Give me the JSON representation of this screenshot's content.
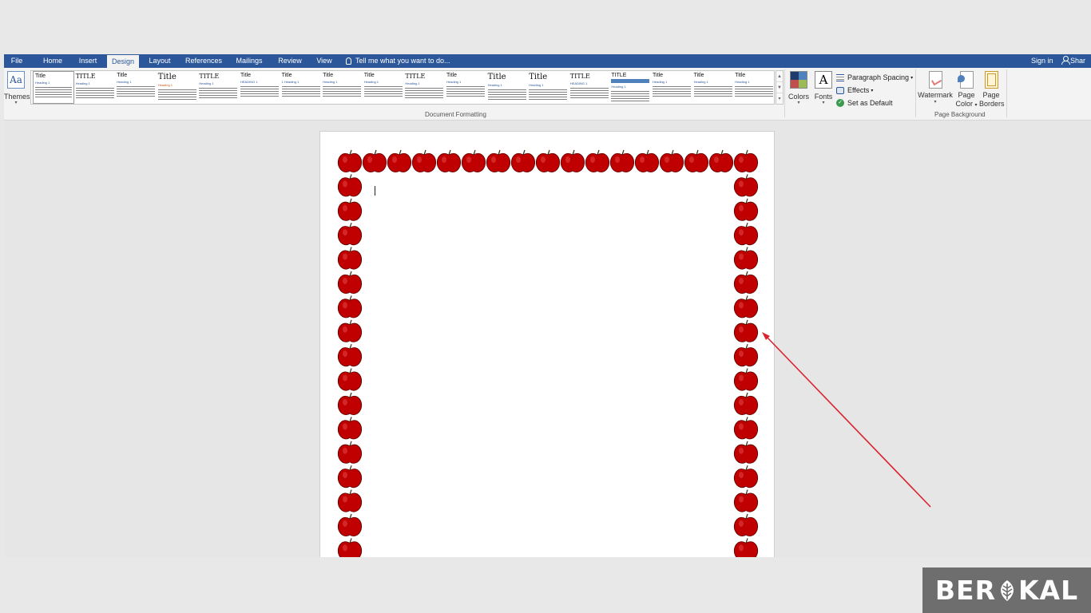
{
  "tabs": [
    {
      "label": "File",
      "active": false
    },
    {
      "label": "Home",
      "active": false
    },
    {
      "label": "Insert",
      "active": false
    },
    {
      "label": "Design",
      "active": true
    },
    {
      "label": "Layout",
      "active": false
    },
    {
      "label": "References",
      "active": false
    },
    {
      "label": "Mailings",
      "active": false
    },
    {
      "label": "Review",
      "active": false
    },
    {
      "label": "View",
      "active": false
    }
  ],
  "tell_me": "Tell me what you want to do...",
  "sign_in": "Sign in",
  "share": "Shar",
  "ribbon": {
    "themes_label": "Themes",
    "themes_icon_text": "Aa",
    "gallery_styles": [
      {
        "title": "Title",
        "heading": "Heading 1"
      },
      {
        "title": "TITLE",
        "heading": "Heading 1"
      },
      {
        "title": "Title",
        "heading": "Heading 1"
      },
      {
        "title": "Title",
        "heading": "Heading 1"
      },
      {
        "title": "TITLE",
        "heading": "Heading 1"
      },
      {
        "title": "Title",
        "heading": "HEADING 1"
      },
      {
        "title": "Title",
        "heading": "1 Heading 1"
      },
      {
        "title": "Title",
        "heading": "Heading 1"
      },
      {
        "title": "Title",
        "heading": "Heading 1"
      },
      {
        "title": "TITLE",
        "heading": "Heading 1"
      },
      {
        "title": "Title",
        "heading": "Heading 1"
      },
      {
        "title": "Title",
        "heading": "Heading 1"
      },
      {
        "title": "Title",
        "heading": "Heading 1"
      },
      {
        "title": "TITLE",
        "heading": "HEADING 1"
      },
      {
        "title": "TITLE",
        "heading": "Heading 1"
      },
      {
        "title": "Title",
        "heading": "Heading 1"
      },
      {
        "title": "Title",
        "heading": "Heading 1"
      },
      {
        "title": "Title",
        "heading": "Heading 1"
      }
    ],
    "document_formatting_label": "Document Formatting",
    "colors_label": "Colors",
    "fonts_label": "Fonts",
    "fonts_icon_text": "A",
    "paragraph_spacing_label": "Paragraph Spacing",
    "effects_label": "Effects",
    "set_default_label": "Set as Default",
    "watermark_label": "Watermark",
    "page_color_label_1": "Page",
    "page_color_label_2": "Color",
    "page_borders_label_1": "Page",
    "page_borders_label_2": "Borders",
    "page_background_label": "Page Background"
  },
  "colors": {
    "tabbar": "#2b579a",
    "apple_border": "#c00000",
    "arrow": "#d9232e",
    "swatch": [
      "#1f3b6e",
      "#4f81bd",
      "#c0504d",
      "#9bbb59"
    ]
  },
  "brand": {
    "before": "BER",
    "after": "KAL"
  }
}
